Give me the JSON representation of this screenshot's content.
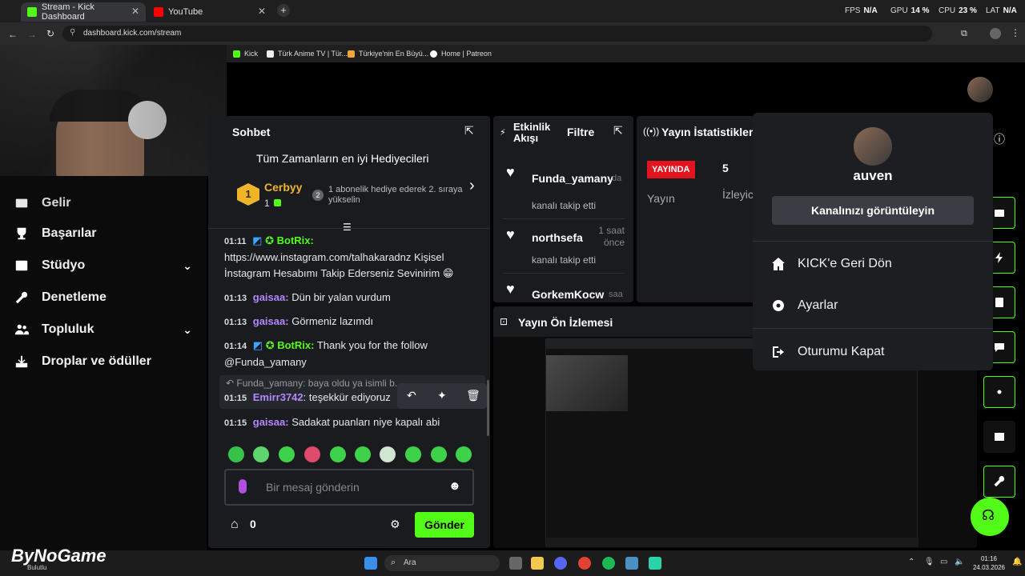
{
  "browser": {
    "tabs": [
      {
        "label": "Stream - Kick Dashboard",
        "active": true
      },
      {
        "label": "YouTube",
        "active": false
      }
    ],
    "url": "dashboard.kick.com/stream",
    "bookmarks": [
      "Kick",
      "Türk Anime TV | Tür...",
      "Türkiye'nin En Büyü...",
      "Home | Patreon"
    ]
  },
  "hud": {
    "fps_label": "FPS",
    "fps_value": "N/A",
    "gpu_label": "GPU",
    "gpu_value": "14 %",
    "cpu_label": "CPU",
    "cpu_value": "23 %",
    "lat_label": "LAT",
    "lat_value": "N/A"
  },
  "sidebar": {
    "partial_item": "Gelir",
    "items": [
      {
        "label": "Başarılar",
        "icon": "trophy-icon"
      },
      {
        "label": "Stüdyo",
        "icon": "studio-icon",
        "expandable": true
      },
      {
        "label": "Denetleme",
        "icon": "wrench-icon"
      },
      {
        "label": "Topluluk",
        "icon": "community-icon",
        "expandable": true
      },
      {
        "label": "Droplar ve ödüller",
        "icon": "drops-icon"
      }
    ]
  },
  "chat": {
    "title": "Sohbet",
    "gifters_title": "Tüm Zamanların en iyi Hediyecileri",
    "top_gifter": {
      "rank": "1",
      "name": "Cerbyy",
      "count": "1"
    },
    "next_rank": "2",
    "next_rank_text": "1 abonelik hediye ederek 2. sıraya yükselin",
    "messages": [
      {
        "time": "01:11",
        "user": "BotRix",
        "color": "green",
        "text": "https://www.instagram.com/talhakaradnz Kişisel İnstagram Hesabımı Takip Ederseniz Sevinirim 😁"
      },
      {
        "time": "01:13",
        "user": "gaisaa",
        "color": "purple",
        "text": "Dün bir yalan vurdum"
      },
      {
        "time": "01:13",
        "user": "gaisaa",
        "color": "purple",
        "text": "Görmeniz lazımdı"
      },
      {
        "time": "01:14",
        "user": "BotRix",
        "color": "green",
        "text": "Thank you for the follow @Funda_yamany"
      },
      {
        "time": "01:15",
        "user": "Emirr3742",
        "color": "purple",
        "text": "teşekkür ediyoruz",
        "reply": "Funda_yamany: baya oldu ya isimli b..."
      },
      {
        "time": "01:15",
        "user": "gaisaa",
        "color": "purple",
        "text": "Sadakat puanları niye kapalı abi"
      }
    ],
    "input_placeholder": "Bir mesaj gönderin",
    "points": "0",
    "send_label": "Gönder"
  },
  "feed": {
    "title": "Etkinlik Akışı",
    "filter_label": "Filtre",
    "events": [
      {
        "user": "Funda_yamany",
        "time": "da",
        "action": "kanalı takip etti"
      },
      {
        "user": "northsefa",
        "time": "1 saat önce",
        "action": "kanalı takip etti"
      },
      {
        "user": "GorkemKocw",
        "time": "saa",
        "action": ""
      }
    ]
  },
  "stats": {
    "title": "Yayın İstatistikleri",
    "live_badge": "YAYINDA",
    "viewers_value": "5",
    "label_stream": "Yayın",
    "label_viewers": "İzleyic"
  },
  "preview": {
    "title": "Yayın Ön İzlemesi"
  },
  "menu": {
    "username": "auven",
    "view_channel": "Kanalınızı görüntüleyin",
    "items": [
      {
        "label": "KICK'e Geri Dön",
        "icon": "home-icon"
      },
      {
        "label": "Ayarlar",
        "icon": "gear-icon"
      },
      {
        "label": "Oturumu Kapat",
        "icon": "logout-icon"
      }
    ]
  },
  "watermark": {
    "brand": "ByNoGame",
    "sub": "Bulutlu"
  },
  "taskbar": {
    "search_label": "Ara",
    "time": "01:16",
    "date": "24.03.2026"
  },
  "colors": {
    "accent": "#53fc18",
    "live": "#e4141e",
    "purple": "#b388ff"
  }
}
